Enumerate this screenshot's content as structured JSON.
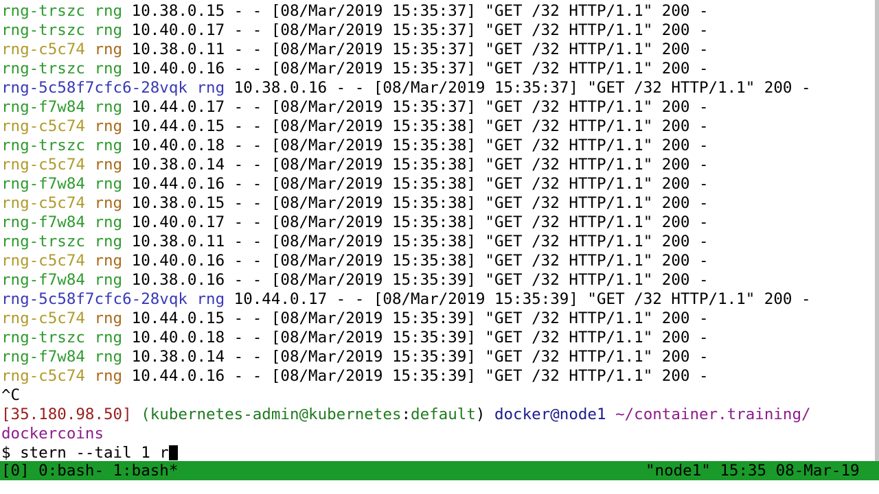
{
  "log_lines": [
    {
      "pod": "rng-trszc",
      "container": "rng",
      "msg": " 10.38.0.15 - - [08/Mar/2019 15:35:37] \"GET /32 HTTP/1.1\" 200 -",
      "pod_color": "#2e9a2e",
      "container_color": "#2e9a2e"
    },
    {
      "pod": "rng-trszc",
      "container": "rng",
      "msg": " 10.40.0.17 - - [08/Mar/2019 15:35:37] \"GET /32 HTTP/1.1\" 200 -",
      "pod_color": "#2e9a2e",
      "container_color": "#2e9a2e"
    },
    {
      "pod": "rng-c5c74",
      "container": "rng",
      "msg": " 10.38.0.11 - - [08/Mar/2019 15:35:37] \"GET /32 HTTP/1.1\" 200 -",
      "pod_color": "#b09a2a",
      "container_color": "#a86a1a"
    },
    {
      "pod": "rng-trszc",
      "container": "rng",
      "msg": " 10.40.0.16 - - [08/Mar/2019 15:35:37] \"GET /32 HTTP/1.1\" 200 -",
      "pod_color": "#2e9a2e",
      "container_color": "#2e9a2e"
    },
    {
      "pod": "rng-5c58f7cfc6-28vqk",
      "container": "rng",
      "msg": " 10.38.0.16 - - [08/Mar/2019 15:35:37] \"GET /32 HTTP/1.1\" 200 -",
      "pod_color": "#3838b8",
      "container_color": "#3838b8"
    },
    {
      "pod": "rng-f7w84",
      "container": "rng",
      "msg": " 10.44.0.17 - - [08/Mar/2019 15:35:37] \"GET /32 HTTP/1.1\" 200 -",
      "pod_color": "#2e9a2e",
      "container_color": "#2e9a2e"
    },
    {
      "pod": "rng-c5c74",
      "container": "rng",
      "msg": " 10.44.0.15 - - [08/Mar/2019 15:35:38] \"GET /32 HTTP/1.1\" 200 -",
      "pod_color": "#b09a2a",
      "container_color": "#a86a1a"
    },
    {
      "pod": "rng-trszc",
      "container": "rng",
      "msg": " 10.40.0.18 - - [08/Mar/2019 15:35:38] \"GET /32 HTTP/1.1\" 200 -",
      "pod_color": "#2e9a2e",
      "container_color": "#2e9a2e"
    },
    {
      "pod": "rng-c5c74",
      "container": "rng",
      "msg": " 10.38.0.14 - - [08/Mar/2019 15:35:38] \"GET /32 HTTP/1.1\" 200 -",
      "pod_color": "#b09a2a",
      "container_color": "#a86a1a"
    },
    {
      "pod": "rng-f7w84",
      "container": "rng",
      "msg": " 10.44.0.16 - - [08/Mar/2019 15:35:38] \"GET /32 HTTP/1.1\" 200 -",
      "pod_color": "#2e9a2e",
      "container_color": "#2e9a2e"
    },
    {
      "pod": "rng-c5c74",
      "container": "rng",
      "msg": " 10.38.0.15 - - [08/Mar/2019 15:35:38] \"GET /32 HTTP/1.1\" 200 -",
      "pod_color": "#b09a2a",
      "container_color": "#a86a1a"
    },
    {
      "pod": "rng-f7w84",
      "container": "rng",
      "msg": " 10.40.0.17 - - [08/Mar/2019 15:35:38] \"GET /32 HTTP/1.1\" 200 -",
      "pod_color": "#2e9a2e",
      "container_color": "#2e9a2e"
    },
    {
      "pod": "rng-trszc",
      "container": "rng",
      "msg": " 10.38.0.11 - - [08/Mar/2019 15:35:38] \"GET /32 HTTP/1.1\" 200 -",
      "pod_color": "#2e9a2e",
      "container_color": "#2e9a2e"
    },
    {
      "pod": "rng-c5c74",
      "container": "rng",
      "msg": " 10.40.0.16 - - [08/Mar/2019 15:35:38] \"GET /32 HTTP/1.1\" 200 -",
      "pod_color": "#b09a2a",
      "container_color": "#a86a1a"
    },
    {
      "pod": "rng-f7w84",
      "container": "rng",
      "msg": " 10.38.0.16 - - [08/Mar/2019 15:35:39] \"GET /32 HTTP/1.1\" 200 -",
      "pod_color": "#2e9a2e",
      "container_color": "#2e9a2e"
    },
    {
      "pod": "rng-5c58f7cfc6-28vqk",
      "container": "rng",
      "msg": " 10.44.0.17 - - [08/Mar/2019 15:35:39] \"GET /32 HTTP/1.1\" 200 -",
      "pod_color": "#3838b8",
      "container_color": "#3838b8"
    },
    {
      "pod": "rng-c5c74",
      "container": "rng",
      "msg": " 10.44.0.15 - - [08/Mar/2019 15:35:39] \"GET /32 HTTP/1.1\" 200 -",
      "pod_color": "#b09a2a",
      "container_color": "#a86a1a"
    },
    {
      "pod": "rng-trszc",
      "container": "rng",
      "msg": " 10.40.0.18 - - [08/Mar/2019 15:35:39] \"GET /32 HTTP/1.1\" 200 -",
      "pod_color": "#2e9a2e",
      "container_color": "#2e9a2e"
    },
    {
      "pod": "rng-f7w84",
      "container": "rng",
      "msg": " 10.38.0.14 - - [08/Mar/2019 15:35:39] \"GET /32 HTTP/1.1\" 200 -",
      "pod_color": "#2e9a2e",
      "container_color": "#2e9a2e"
    },
    {
      "pod": "rng-c5c74",
      "container": "rng",
      "msg": " 10.44.0.16 - - [08/Mar/2019 15:35:39] \"GET /32 HTTP/1.1\" 200 -",
      "pod_color": "#b09a2a",
      "container_color": "#a86a1a"
    }
  ],
  "interrupt": "^C",
  "prompt": {
    "ip": "[35.180.98.50]",
    "context_open": " (",
    "context_user": "kubernetes-admin@kubernetes",
    "context_sep": ":",
    "context_ns": "default",
    "context_close": ")",
    "user_host": " docker@node1",
    "path": " ~/container.training/",
    "path_cont": "dockercoins",
    "symbol": "$ ",
    "command": "stern --tail 1 r"
  },
  "statusbar": {
    "left": "[0] 0:bash- 1:bash*",
    "right": "\"node1\" 15:35 08-Mar-19"
  },
  "colors": {
    "status_bg": "#1a9a2a",
    "ip": "#9b1c1c",
    "context": "#1f7a1f",
    "user_host": "#1c1c8c",
    "path": "#8c1c8c"
  }
}
